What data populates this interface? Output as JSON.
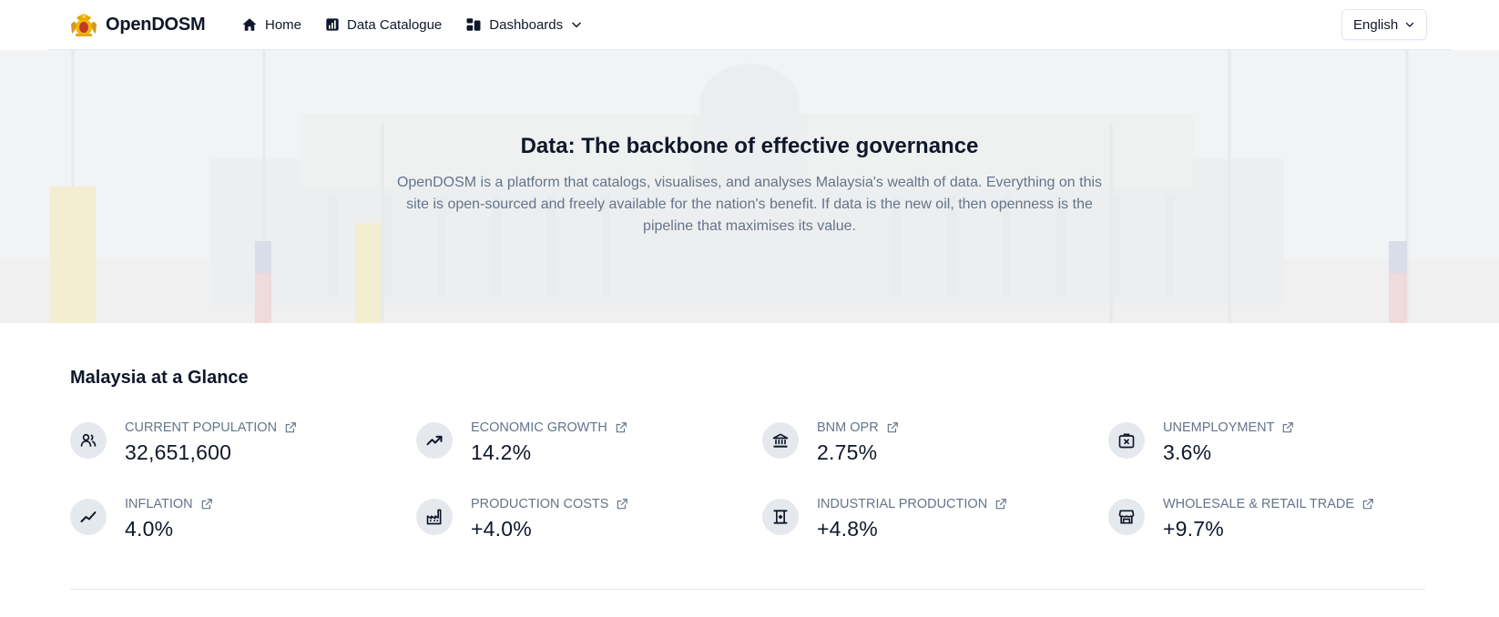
{
  "nav": {
    "brand": "OpenDOSM",
    "links": [
      {
        "label": "Home",
        "icon": "home-icon"
      },
      {
        "label": "Data Catalogue",
        "icon": "bar-chart-icon"
      },
      {
        "label": "Dashboards",
        "icon": "dashboard-icon"
      }
    ],
    "language": "English"
  },
  "hero": {
    "title": "Data: The backbone of effective governance",
    "description": "OpenDOSM is a platform that catalogs, visualises, and analyses Malaysia's wealth of data. Everything on this site is open-sourced and freely available for the nation's benefit. If data is the new oil, then openness is the pipeline that maximises its value."
  },
  "glance": {
    "title": "Malaysia at a Glance",
    "stats": [
      {
        "label": "CURRENT POPULATION",
        "value": "32,651,600",
        "icon": "users-icon"
      },
      {
        "label": "ECONOMIC GROWTH",
        "value": "14.2%",
        "icon": "trending-up-icon"
      },
      {
        "label": "BNM OPR",
        "value": "2.75%",
        "icon": "bank-icon"
      },
      {
        "label": "UNEMPLOYMENT",
        "value": "3.6%",
        "icon": "briefcase-x-icon"
      },
      {
        "label": "INFLATION",
        "value": "4.0%",
        "icon": "trending-line-icon"
      },
      {
        "label": "PRODUCTION COSTS",
        "value": "+4.0%",
        "icon": "factory-icon"
      },
      {
        "label": "INDUSTRIAL PRODUCTION",
        "value": "+4.8%",
        "icon": "industry-icon"
      },
      {
        "label": "WHOLESALE & RETAIL TRADE",
        "value": "+9.7%",
        "icon": "store-icon"
      }
    ]
  },
  "colors": {
    "text": "#0f172a",
    "muted": "#64748b",
    "icon_bg": "#e5e9ee",
    "border": "#e2e8f0"
  }
}
